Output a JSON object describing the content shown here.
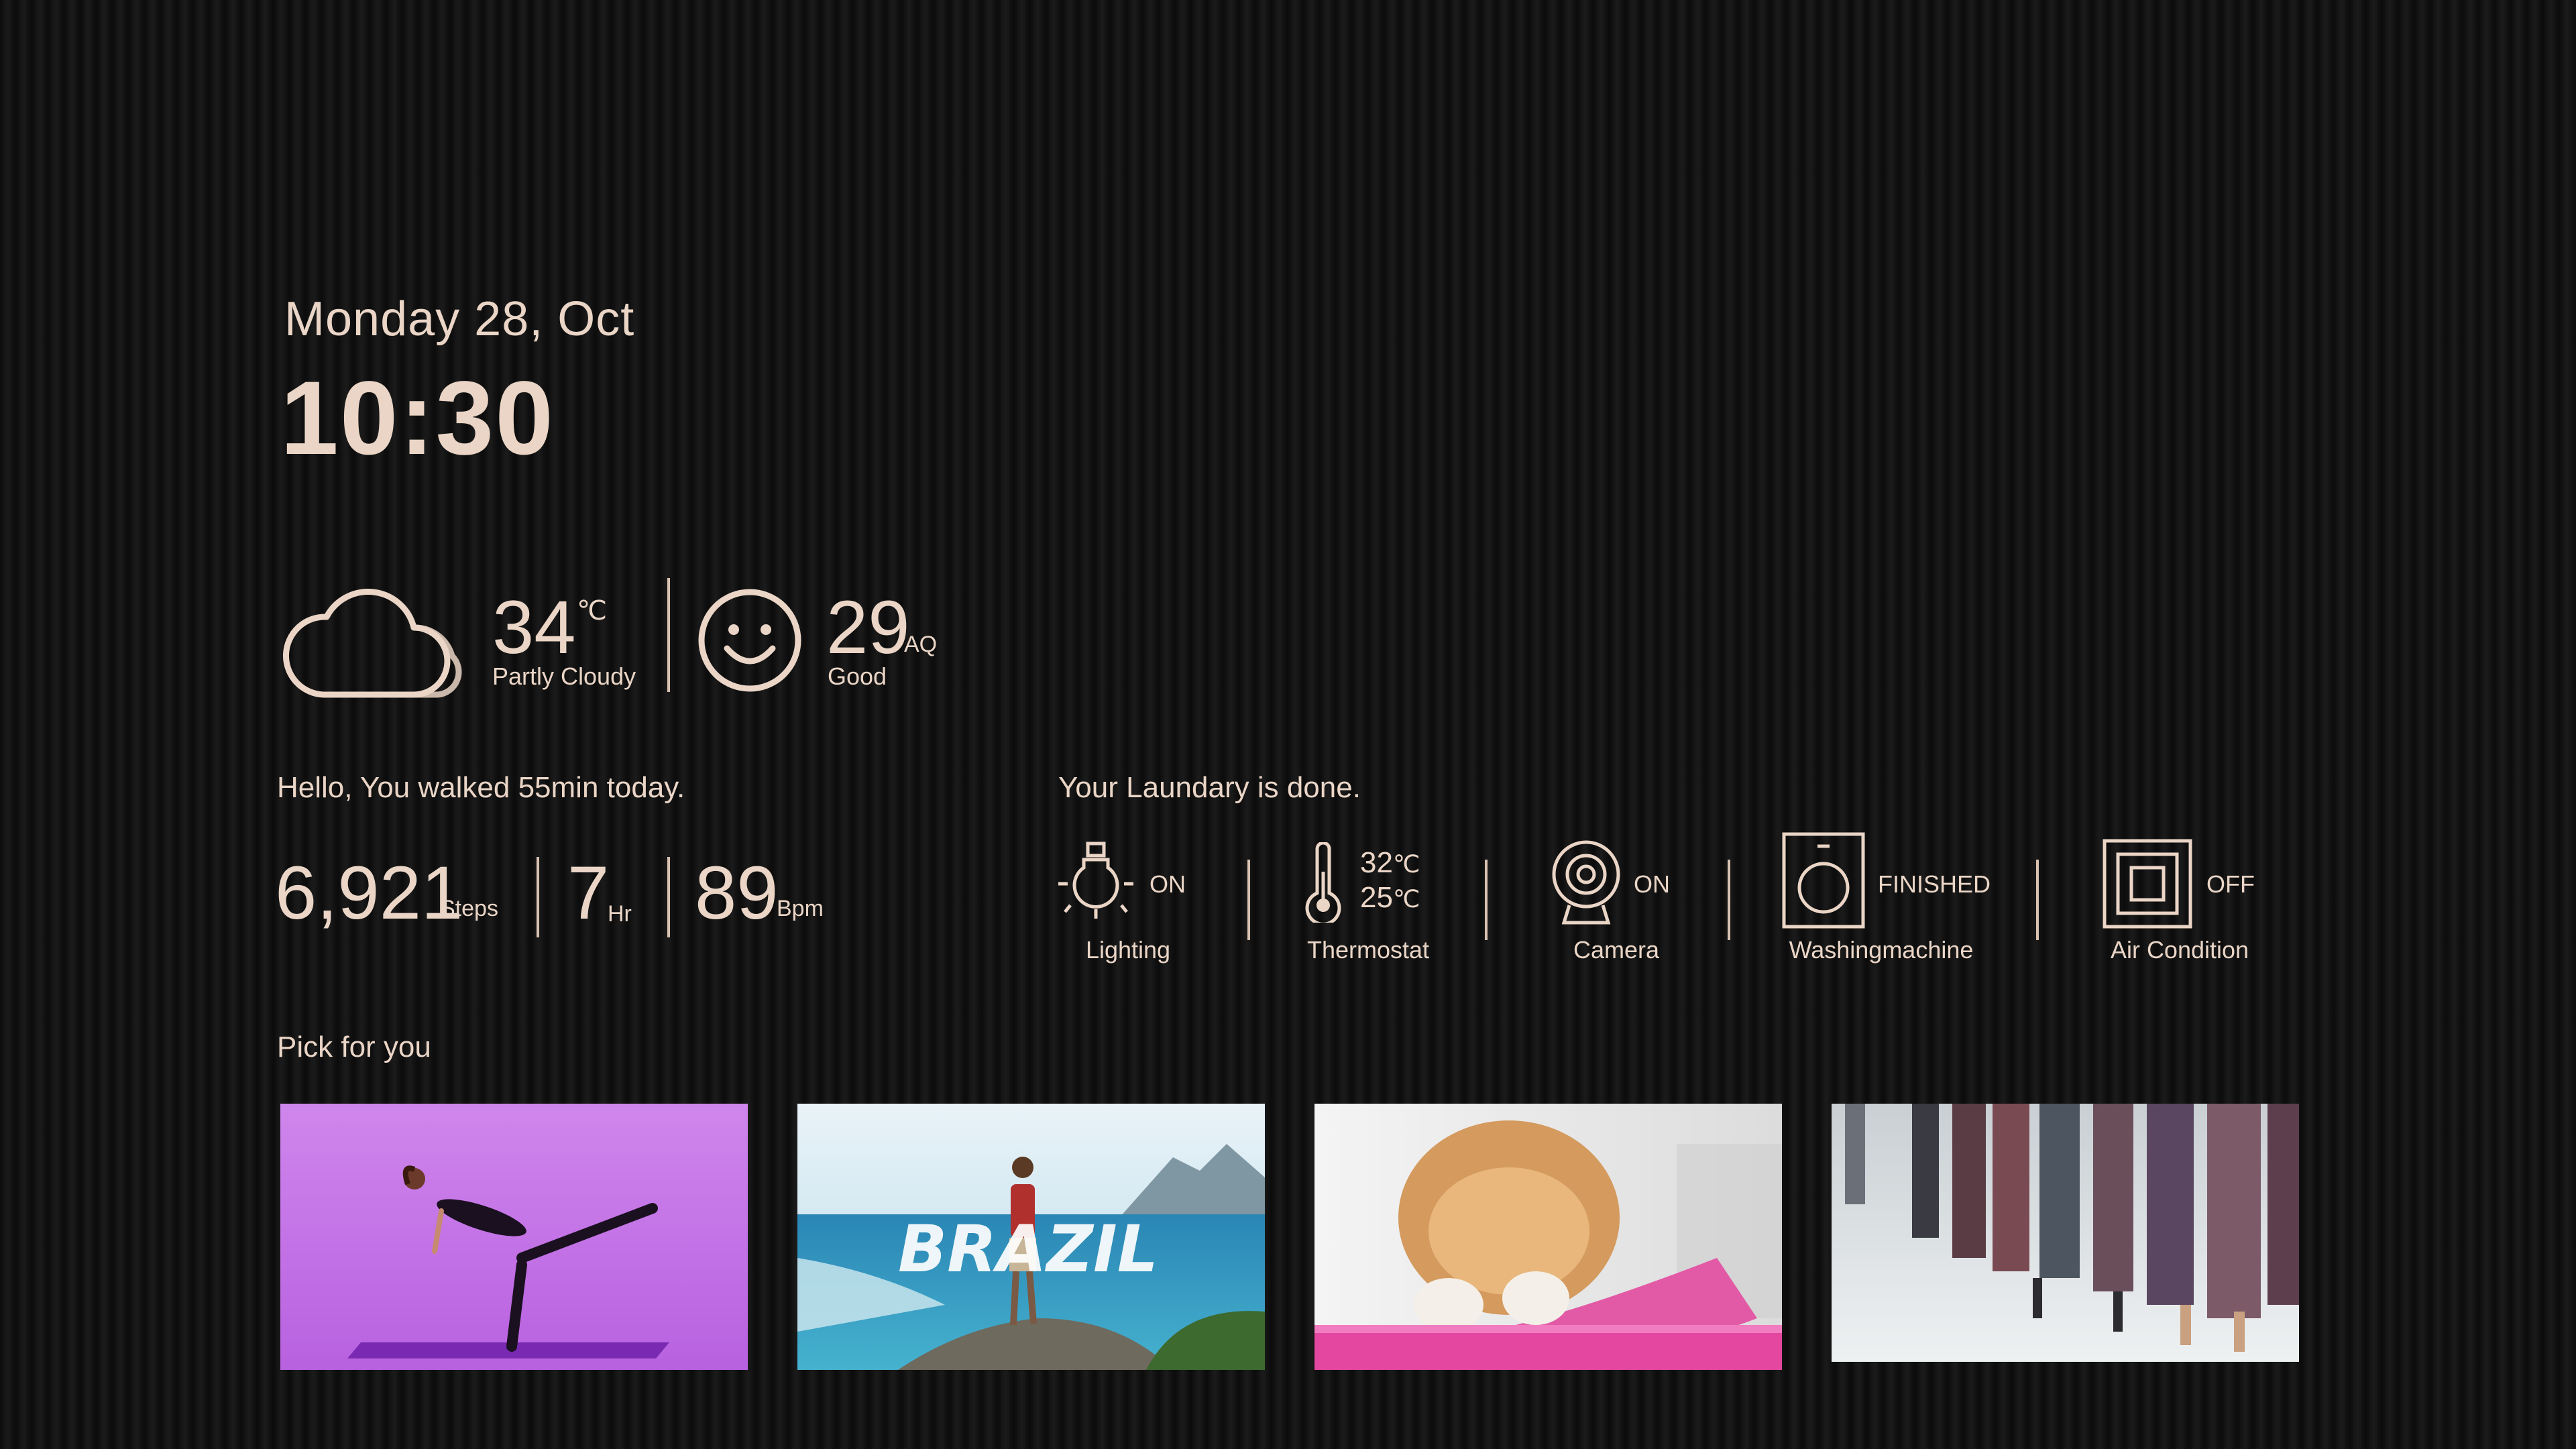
{
  "date": "Monday 28, Oct",
  "time": "10:30",
  "weather": {
    "icon": "cloud-icon",
    "temperature": "34",
    "unit": "℃",
    "condition": "Partly Cloudy"
  },
  "air_quality": {
    "icon": "smiley-face-icon",
    "value": "29",
    "unit": "AQ",
    "status": "Good"
  },
  "activity": {
    "greeting": "Hello, You walked 55min today.",
    "steps_value": "6,921",
    "steps_unit": "Steps",
    "hours_value": "7",
    "hours_unit": "Hr",
    "bpm_value": "89",
    "bpm_unit": "Bpm"
  },
  "home": {
    "message": "Your Laundary is done.",
    "devices": [
      {
        "icon": "light-bulb-icon",
        "status": "ON",
        "label": "Lighting"
      },
      {
        "icon": "thermometer-icon",
        "temp_high": "32",
        "temp_low": "25",
        "unit": "℃",
        "label": "Thermostat"
      },
      {
        "icon": "camera-icon",
        "status": "ON",
        "label": "Camera"
      },
      {
        "icon": "washing-machine-icon",
        "status": "FINISHED",
        "label": "Washingmachine"
      },
      {
        "icon": "air-conditioner-icon",
        "status": "OFF",
        "label": "Air Condition"
      }
    ]
  },
  "picks": {
    "title": "Pick for you",
    "cards": [
      {
        "name": "yoga-card",
        "overlay": ""
      },
      {
        "name": "brazil-travel-card",
        "overlay": "BRAZIL"
      },
      {
        "name": "puppy-card",
        "overlay": ""
      },
      {
        "name": "fashion-runway-card",
        "overlay": ""
      }
    ]
  },
  "colors": {
    "background": "#111111",
    "text": "#ead5c6",
    "divider": "#d9c2b1",
    "yoga_bg": "#c77be6",
    "ocean": "#3a9ec2",
    "pink": "#e64fae"
  }
}
